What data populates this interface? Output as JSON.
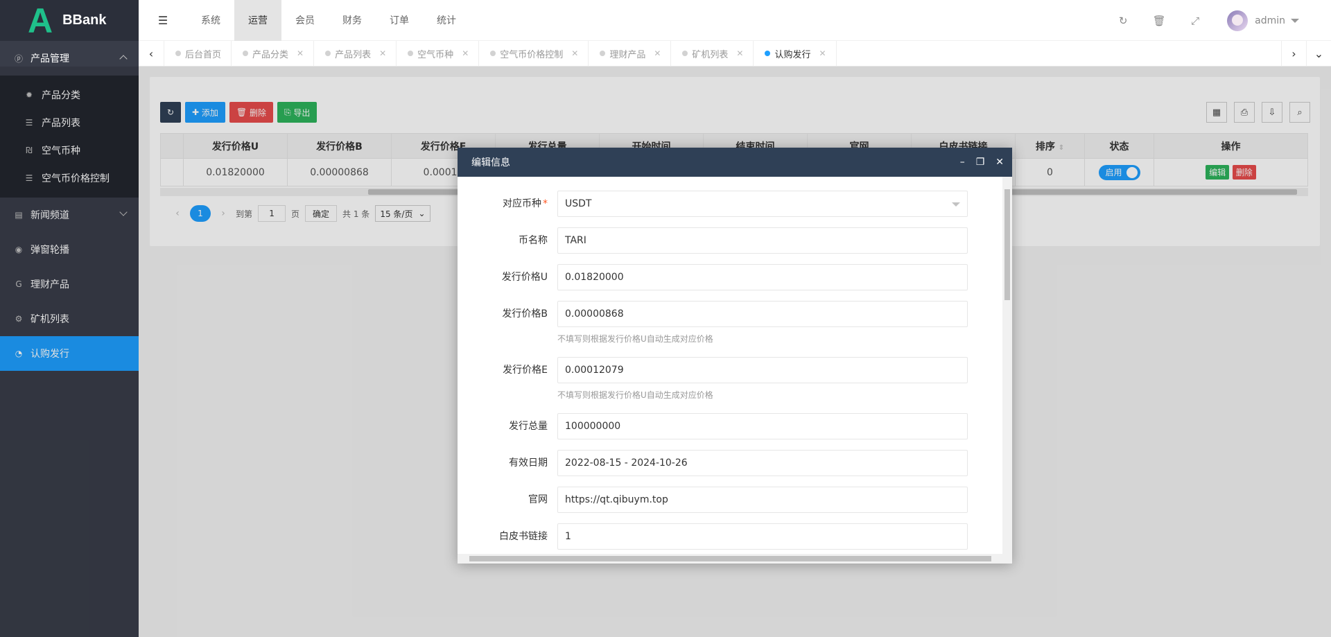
{
  "logo": {
    "mark": "A",
    "text": "BBank"
  },
  "sidebar": {
    "groups": [
      {
        "label": "产品管理",
        "icon": "product-icon",
        "expanded": true,
        "items": [
          {
            "label": "产品分类",
            "icon": "gear-icon"
          },
          {
            "label": "产品列表",
            "icon": "list-icon"
          },
          {
            "label": "空气币种",
            "icon": "coin-icon"
          },
          {
            "label": "空气币价格控制",
            "icon": "list-icon"
          }
        ]
      },
      {
        "label": "新闻频道",
        "icon": "news-icon",
        "expanded": false
      },
      {
        "label": "弹窗轮播",
        "icon": "carousel-icon"
      },
      {
        "label": "理财产品",
        "icon": "finance-icon"
      },
      {
        "label": "矿机列表",
        "icon": "miner-icon"
      },
      {
        "label": "认购发行",
        "icon": "pie-icon",
        "active": true
      }
    ]
  },
  "header": {
    "nav": [
      "系统",
      "运营",
      "会员",
      "财务",
      "订单",
      "统计"
    ],
    "active_nav": "运营",
    "admin": "admin"
  },
  "tabs": [
    {
      "label": "后台首页"
    },
    {
      "label": "产品分类"
    },
    {
      "label": "产品列表"
    },
    {
      "label": "空气币种"
    },
    {
      "label": "空气币价格控制"
    },
    {
      "label": "理财产品"
    },
    {
      "label": "矿机列表"
    },
    {
      "label": "认购发行",
      "active": true
    }
  ],
  "toolbar": {
    "add": "添加",
    "delete": "删除",
    "export": "导出"
  },
  "table": {
    "headers": [
      "发行价格U",
      "发行价格B",
      "发行价格E",
      "发行总量",
      "开始时间",
      "结束时间",
      "官网",
      "白皮书链接",
      "排序",
      "状态",
      "操作"
    ],
    "row": {
      "price_u": "0.01820000",
      "price_b": "0.00000868",
      "price_e": "0.00012",
      "sort": "0",
      "status": "启用",
      "edit": "编辑",
      "delete": "删除"
    }
  },
  "pager": {
    "current": "1",
    "goto_label": "到第",
    "goto_value": "1",
    "page_label": "页",
    "confirm": "确定",
    "total": "共 1 条",
    "per_page": "15 条/页"
  },
  "modal": {
    "title": "编辑信息",
    "fields": {
      "coin": {
        "label": "对应币种",
        "value": "USDT",
        "required": "*"
      },
      "name": {
        "label": "币名称",
        "value": "TARI"
      },
      "price_u": {
        "label": "发行价格U",
        "value": "0.01820000"
      },
      "price_b": {
        "label": "发行价格B",
        "value": "0.00000868",
        "hint": "不填写则根据发行价格U自动生成对应价格"
      },
      "price_e": {
        "label": "发行价格E",
        "value": "0.00012079",
        "hint": "不填写则根据发行价格U自动生成对应价格"
      },
      "total": {
        "label": "发行总量",
        "value": "100000000"
      },
      "date": {
        "label": "有效日期",
        "value": "2022-08-15 - 2024-10-26"
      },
      "website": {
        "label": "官网",
        "value": "https://qt.qibuym.top"
      },
      "whitepaper": {
        "label": "白皮书链接",
        "value": "1"
      }
    }
  },
  "colors": {
    "sidebar_bg": "#393d49",
    "accent": "#1e9fff",
    "logo_green": "#1fc08a",
    "modal_title_bg": "#2f4056"
  }
}
